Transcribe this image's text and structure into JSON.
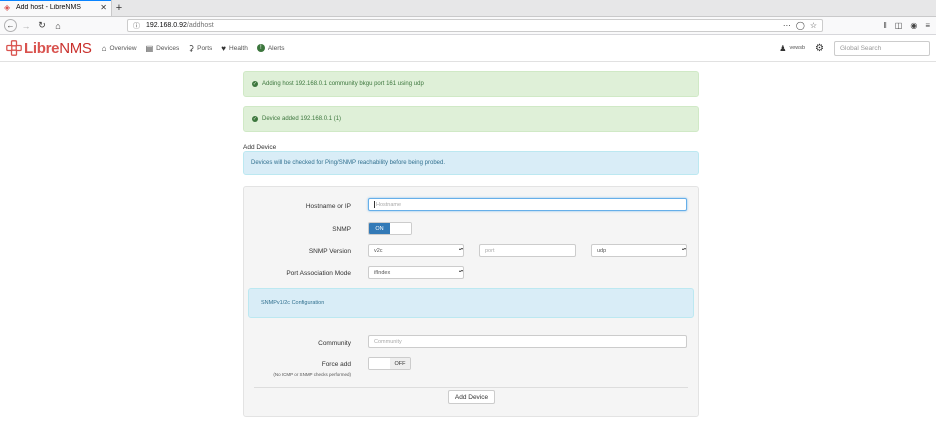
{
  "browser": {
    "tab_title": "Add host - LibreNMS",
    "url_host": "192.168.0.92",
    "url_path": "/addhost"
  },
  "nav": {
    "logo_prefix": "Libre",
    "logo_suffix": "NMS",
    "items": [
      {
        "label": "Overview",
        "icon": "home-icon"
      },
      {
        "label": "Devices",
        "icon": "server-icon"
      },
      {
        "label": "Ports",
        "icon": "link-icon"
      },
      {
        "label": "Health",
        "icon": "heartbeat-icon"
      },
      {
        "label": "Alerts",
        "icon": "alert-icon"
      }
    ],
    "user": "vewsb",
    "search_placeholder": "Global Search"
  },
  "alerts": {
    "adding": "Adding host 192.168.0.1 community bkgu port 161 using udp",
    "added": "Device added 192.168.0.1 (1)"
  },
  "page": {
    "title": "Add Device",
    "info": "Devices will be checked for Ping/SNMP reachability before being probed."
  },
  "form": {
    "hostname_label": "Hostname or IP",
    "hostname_placeholder": "Hostname",
    "snmp_label": "SNMP",
    "snmp_on": "ON",
    "snmp_version_label": "SNMP Version",
    "snmp_version_value": "v2c",
    "port_placeholder": "port",
    "transport_value": "udp",
    "port_assoc_label": "Port Association Mode",
    "port_assoc_value": "ifIndex",
    "snmp_config_heading": "SNMPv1/2c Configuration",
    "community_label": "Community",
    "community_placeholder": "Community",
    "force_add_label": "Force add",
    "force_add_off": "OFF",
    "force_add_hint": "(No ICMP or SNMP checks performed)",
    "submit_label": "Add Device"
  }
}
